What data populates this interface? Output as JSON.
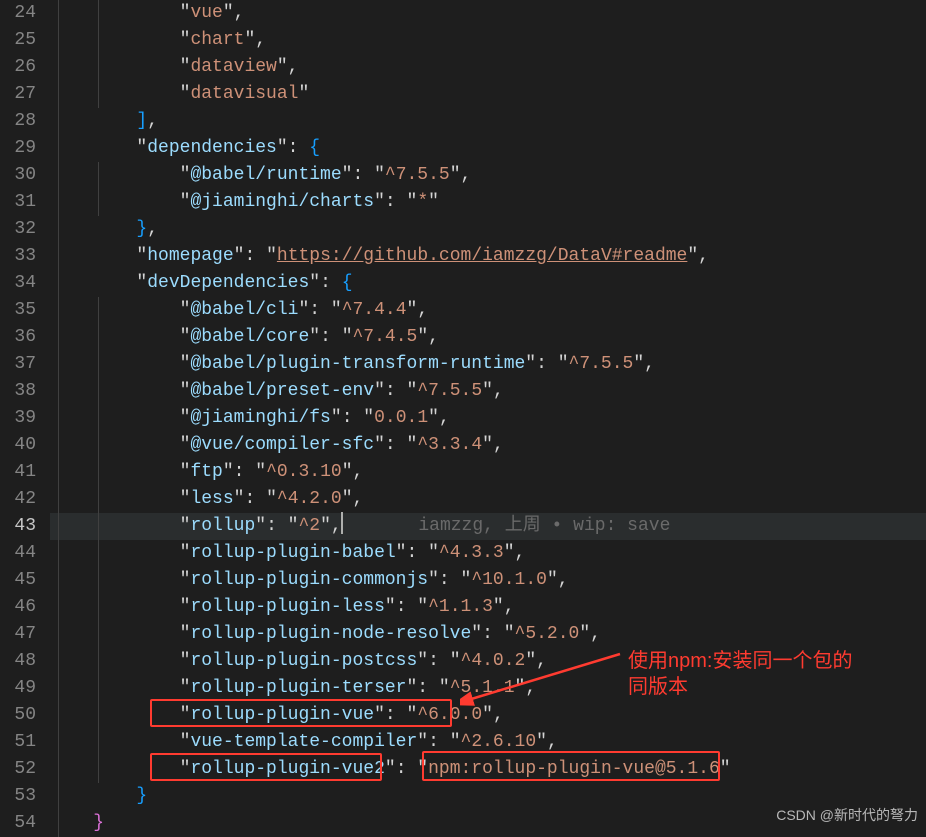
{
  "gutter": {
    "start": 24,
    "end": 54,
    "active": 43
  },
  "lines": {
    "l24": {
      "indent": 3,
      "k": "vue"
    },
    "l25": {
      "indent": 3,
      "k": "chart"
    },
    "l26": {
      "indent": 3,
      "k": "dataview"
    },
    "l27": {
      "indent": 3,
      "k": "datavisual"
    },
    "l29": {
      "indent": 2,
      "k": "dependencies"
    },
    "l30": {
      "indent": 3,
      "k": "@babel/runtime",
      "v": "^7.5.5"
    },
    "l31": {
      "indent": 3,
      "k": "@jiaminghi/charts",
      "v": "*"
    },
    "l33": {
      "indent": 2,
      "k": "homepage",
      "v": "https://github.com/iamzzg/DataV#readme"
    },
    "l34": {
      "indent": 2,
      "k": "devDependencies"
    },
    "l35": {
      "indent": 3,
      "k": "@babel/cli",
      "v": "^7.4.4"
    },
    "l36": {
      "indent": 3,
      "k": "@babel/core",
      "v": "^7.4.5"
    },
    "l37": {
      "indent": 3,
      "k": "@babel/plugin-transform-runtime",
      "v": "^7.5.5"
    },
    "l38": {
      "indent": 3,
      "k": "@babel/preset-env",
      "v": "^7.5.5"
    },
    "l39": {
      "indent": 3,
      "k": "@jiaminghi/fs",
      "v": "0.0.1"
    },
    "l40": {
      "indent": 3,
      "k": "@vue/compiler-sfc",
      "v": "^3.3.4"
    },
    "l41": {
      "indent": 3,
      "k": "ftp",
      "v": "^0.3.10"
    },
    "l42": {
      "indent": 3,
      "k": "less",
      "v": "^4.2.0"
    },
    "l43": {
      "indent": 3,
      "k": "rollup",
      "v": "^2",
      "blame": "iamzzg, 上周 • wip: save"
    },
    "l44": {
      "indent": 3,
      "k": "rollup-plugin-babel",
      "v": "^4.3.3"
    },
    "l45": {
      "indent": 3,
      "k": "rollup-plugin-commonjs",
      "v": "^10.1.0"
    },
    "l46": {
      "indent": 3,
      "k": "rollup-plugin-less",
      "v": "^1.1.3"
    },
    "l47": {
      "indent": 3,
      "k": "rollup-plugin-node-resolve",
      "v": "^5.2.0"
    },
    "l48": {
      "indent": 3,
      "k": "rollup-plugin-postcss",
      "v": "^4.0.2"
    },
    "l49": {
      "indent": 3,
      "k": "rollup-plugin-terser",
      "v": "^5.1.1"
    },
    "l50": {
      "indent": 3,
      "k": "rollup-plugin-vue",
      "v": "^6.0.0"
    },
    "l51": {
      "indent": 3,
      "k": "vue-template-compiler",
      "v": "^2.6.10"
    },
    "l52": {
      "indent": 3,
      "k": "rollup-plugin-vue2",
      "v": "npm:rollup-plugin-vue@5.1.6"
    }
  },
  "annotation": {
    "line1": "使用npm:安装同一个包的",
    "line2": "同版本"
  },
  "watermark": "CSDN @新时代的弩力"
}
